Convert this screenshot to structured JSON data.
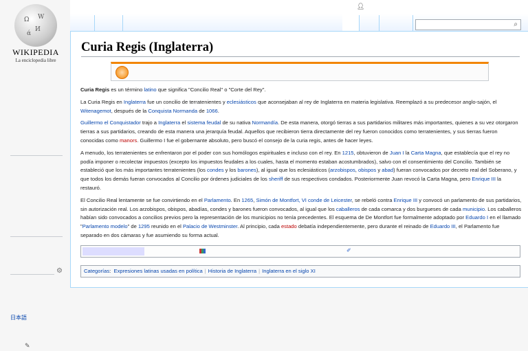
{
  "logo": {
    "wordmark": "WIKIPEDIA",
    "tagline": "La enciclopedia libre"
  },
  "sidebar": {
    "languages": [
      {
        "label": "日本語"
      }
    ]
  },
  "icons": {
    "user": "user-icon",
    "search": "search-icon",
    "gear": "gear-icon",
    "pencil": "pencil-icon",
    "notice": "notice-icon"
  },
  "colors": {
    "link": "#0645ad",
    "redlink": "#ba0000",
    "notice_border": "#f28500",
    "frame": "#a7d7f9"
  },
  "article": {
    "title": "Curia Regis (Inglaterra)",
    "paragraphs": [
      [
        [
          "b",
          "Curia Regis"
        ],
        [
          "t",
          " es un término "
        ],
        [
          "a",
          "latino"
        ],
        [
          "t",
          " que significa \"Concilio Real\" o \"Corte del Rey\"."
        ]
      ],
      [
        [
          "t",
          "La Curia Regis en "
        ],
        [
          "a",
          "Inglaterra"
        ],
        [
          "t",
          " fue un concilio de terratenientes y "
        ],
        [
          "a",
          "eclesiásticos"
        ],
        [
          "t",
          " que aconsejaban al rey de Inglaterra en materia legislativa. Reemplazó a su predecesor anglo-sajón, el "
        ],
        [
          "a",
          "Witenagemot"
        ],
        [
          "t",
          ", después de la "
        ],
        [
          "a",
          "Conquista Normanda"
        ],
        [
          "t",
          " de "
        ],
        [
          "a",
          "1066"
        ],
        [
          "t",
          "."
        ]
      ],
      [
        [
          "a",
          "Guillermo el Conquistador"
        ],
        [
          "t",
          " trajo a "
        ],
        [
          "a",
          "Inglaterra"
        ],
        [
          "t",
          " el "
        ],
        [
          "a",
          "sistema feudal"
        ],
        [
          "t",
          " de su nativa "
        ],
        [
          "a",
          "Normandía"
        ],
        [
          "t",
          ". De esta manera, otorgó tierras a sus partidarios militares más importantes, quienes a su vez otorgaron tierras a sus partidarios, creando de esta manera una jerarquía feudal. Aquellos que recibieron tierra directamente del rey fueron conocidos como terratenientes, y sus tierras fueron conocidas como "
        ],
        [
          "r",
          "manors"
        ],
        [
          "t",
          ". Guillermo I fue el gobernante absoluto, pero buscó el consejo de la curia regis, antes de hacer leyes."
        ]
      ],
      [
        [
          "t",
          "A menudo, los terratenientes se enfrentaron por el poder con sus homólogos espirituales e incluso con el rey. En "
        ],
        [
          "a",
          "1215"
        ],
        [
          "t",
          ", obtuvieron de "
        ],
        [
          "a",
          "Juan I"
        ],
        [
          "t",
          " la "
        ],
        [
          "a",
          "Carta Magna"
        ],
        [
          "t",
          ", que establecía que el rey no podía imponer o recolectar impuestos (excepto los impuestos feudales a los cuales, hasta el momento estaban acostumbrados), salvo con el consentimiento del Concilio. También se estableció que los más importantes terratenientes (los "
        ],
        [
          "a",
          "condes"
        ],
        [
          "t",
          " y los "
        ],
        [
          "a",
          "barones"
        ],
        [
          "t",
          "), al igual que los eclesiásticos ("
        ],
        [
          "a",
          "arzobispos"
        ],
        [
          "t",
          ", "
        ],
        [
          "a",
          "obispos"
        ],
        [
          "t",
          " y "
        ],
        [
          "a",
          "abad"
        ],
        [
          "t",
          ") fueran convocados por decreto real del Soberano, y que todos los demás fueran convocados al Concilio por órdenes judiciales de los "
        ],
        [
          "a",
          "sheriff"
        ],
        [
          "t",
          " de sus respectivos condados. Posteriormente Juan revocó la Carta Magna, pero "
        ],
        [
          "a",
          "Enrique III"
        ],
        [
          "t",
          " la restauró."
        ]
      ],
      [
        [
          "t",
          "El Concilio Real lentamente se fue convirtiendo en el "
        ],
        [
          "a",
          "Parlamento"
        ],
        [
          "t",
          ". En "
        ],
        [
          "a",
          "1265"
        ],
        [
          "t",
          ", "
        ],
        [
          "a",
          "Simón de Montfort, VI conde de Leicester"
        ],
        [
          "t",
          ", se rebeló contra "
        ],
        [
          "a",
          "Enrique III"
        ],
        [
          "t",
          " y convocó un parlamento de sus partidarios, sin autorización real. Los arzobispos, obispos, abadías, condes y barones fueron convocados, al igual que los "
        ],
        [
          "a",
          "caballeros"
        ],
        [
          "t",
          " de cada comarca y dos burgueses de cada "
        ],
        [
          "a",
          "municipio"
        ],
        [
          "t",
          ". Los caballeros habían sido convocados a concilios previos pero la representación de los municipios no tenía precedentes. El esquema de De Montfort fue formalmente adoptado por "
        ],
        [
          "a",
          "Eduardo I"
        ],
        [
          "t",
          " en el llamado \""
        ],
        [
          "a",
          "Parlamento modelo"
        ],
        [
          "t",
          "\" de "
        ],
        [
          "a",
          "1295"
        ],
        [
          "t",
          " reunido en el "
        ],
        [
          "a",
          "Palacio de Westminster"
        ],
        [
          "t",
          ". Al principio, cada "
        ],
        [
          "r",
          "estado"
        ],
        [
          "t",
          " debatía independientemente, pero durante el reinado de "
        ],
        [
          "a",
          "Eduardo III"
        ],
        [
          "t",
          ", el Parlamento fue separado en dos cámaras y fue asumiendo su forma actual."
        ]
      ]
    ]
  },
  "categories": {
    "label": "Categorías",
    "items": [
      "Expresiones latinas usadas en política",
      "Historia de Inglaterra",
      "Inglaterra en el siglo XI"
    ]
  }
}
